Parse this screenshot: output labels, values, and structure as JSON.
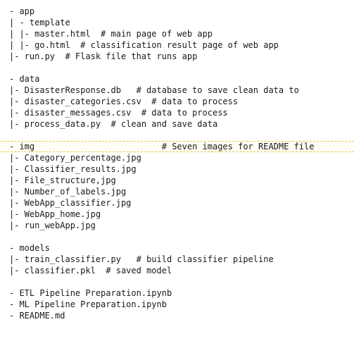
{
  "lines": [
    {
      "text": "- app"
    },
    {
      "text": "| - template"
    },
    {
      "text": "| |- master.html  # main page of web app"
    },
    {
      "text": "| |- go.html  # classification result page of web app"
    },
    {
      "text": "|- run.py  # Flask file that runs app"
    },
    {
      "text": ""
    },
    {
      "text": "- data"
    },
    {
      "text": "|- DisasterResponse.db   # database to save clean data to"
    },
    {
      "text": "|- disaster_categories.csv  # data to process"
    },
    {
      "text": "|- disaster_messages.csv  # data to process"
    },
    {
      "text": "|- process_data.py  # clean and save data"
    },
    {
      "text": ""
    },
    {
      "text": "- img                         # Seven images for README file",
      "highlight": true
    },
    {
      "text": "|- Category_percentage.jpg"
    },
    {
      "text": "|- Classifier_results.jpg"
    },
    {
      "text": "|- File_structure,jpg"
    },
    {
      "text": "|- Number_of_labels.jpg"
    },
    {
      "text": "|- WebApp_classifier.jpg"
    },
    {
      "text": "|- WebApp_home.jpg"
    },
    {
      "text": "|- run_webApp.jpg"
    },
    {
      "text": ""
    },
    {
      "text": "- models"
    },
    {
      "text": "|- train_classifier.py   # build classifier pipeline"
    },
    {
      "text": "|- classifier.pkl  # saved model"
    },
    {
      "text": ""
    },
    {
      "text": "- ETL Pipeline Preparation.ipynb"
    },
    {
      "text": "- ML Pipeline Preparation.ipynb"
    },
    {
      "text": "- README.md"
    }
  ]
}
